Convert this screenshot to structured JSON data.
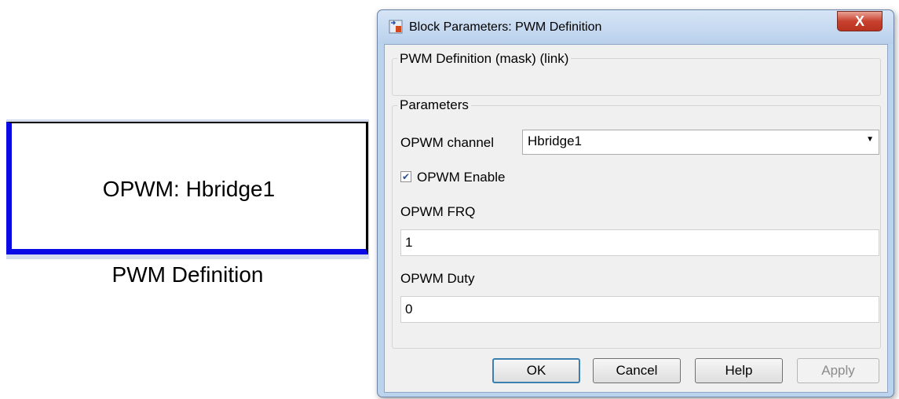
{
  "block": {
    "text": "OPWM: Hbridge1",
    "caption": "PWM Definition"
  },
  "dialog": {
    "title": "Block Parameters: PWM Definition",
    "close_glyph": "X",
    "description_group": "PWM Definition (mask) (link)",
    "parameters_group": "Parameters",
    "channel_label": "OPWM channel",
    "channel_value": "Hbridge1",
    "enable_label": "OPWM Enable",
    "enable_checked": true,
    "frq_label": "OPWM FRQ",
    "frq_value": "1",
    "duty_label": "OPWM Duty",
    "duty_value": "0",
    "buttons": {
      "ok": "OK",
      "cancel": "Cancel",
      "help": "Help",
      "apply": "Apply"
    }
  },
  "colors": {
    "block_accent": "#0a0ae6",
    "window_frame": "#bcd3ee",
    "close_button": "#c8412e",
    "default_button_border": "#3c7fb1"
  },
  "icons": {
    "app": "simulink-block-icon",
    "close": "close-icon",
    "dropdown": "chevron-down-icon",
    "check": "checkmark-icon"
  }
}
